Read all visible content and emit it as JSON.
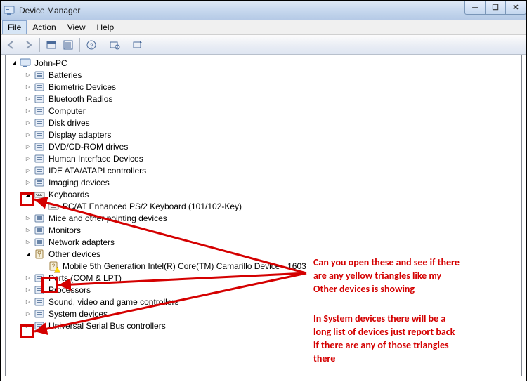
{
  "window": {
    "title": "Device Manager"
  },
  "menu": {
    "file": "File",
    "action": "Action",
    "view": "View",
    "help": "Help"
  },
  "tree": {
    "root": "John-PC",
    "items": [
      {
        "label": "Batteries"
      },
      {
        "label": "Biometric Devices"
      },
      {
        "label": "Bluetooth Radios"
      },
      {
        "label": "Computer"
      },
      {
        "label": "Disk drives"
      },
      {
        "label": "Display adapters"
      },
      {
        "label": "DVD/CD-ROM drives"
      },
      {
        "label": "Human Interface Devices"
      },
      {
        "label": "IDE ATA/ATAPI controllers"
      },
      {
        "label": "Imaging devices"
      }
    ],
    "keyboards": {
      "label": "Keyboards",
      "child": "PC/AT Enhanced PS/2 Keyboard (101/102-Key)"
    },
    "items2": [
      {
        "label": "Mice and other pointing devices"
      },
      {
        "label": "Monitors"
      },
      {
        "label": "Network adapters"
      }
    ],
    "other": {
      "label": "Other devices",
      "child": "Mobile 5th Generation Intel(R) Core(TM) Camarillo Device - 1603"
    },
    "items3": [
      {
        "label": "Ports (COM & LPT)"
      },
      {
        "label": "Processors"
      },
      {
        "label": "Sound, video and game controllers"
      },
      {
        "label": "System devices"
      },
      {
        "label": "Universal Serial Bus controllers"
      }
    ]
  },
  "annotation": {
    "para1": "Can you open these and see if there are any yellow triangles like my Other devices is showing",
    "para2": "In System devices there will be a long list of devices just report back if there are any of those triangles there"
  },
  "colors": {
    "accent_red": "#d40000",
    "warn_yellow": "#ffd700"
  }
}
